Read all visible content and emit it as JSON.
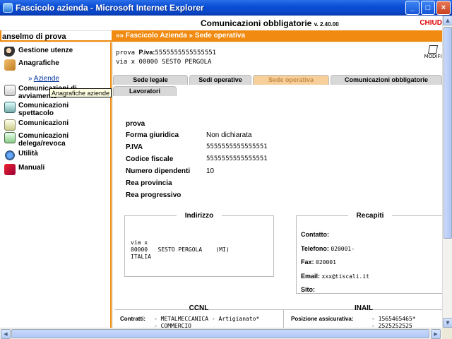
{
  "window": {
    "title": "Fascicolo azienda - Microsoft Internet Explorer",
    "buttons": {
      "minimize": "_",
      "maximize": "□",
      "close": "×"
    }
  },
  "header": {
    "title": "Comunicazioni obbligatorie",
    "version": "v. 2.40.00",
    "close_label": "CHIUD"
  },
  "user": {
    "name": "anselmo di prova"
  },
  "breadcrumb": "»» Fascicolo Azienda » Sede operativa",
  "sidebar": {
    "items": [
      {
        "label": "Gestione utenze",
        "icon": "users-icon"
      },
      {
        "label": "Anagrafiche",
        "icon": "book-icon"
      },
      {
        "label": "Comunicazioni di\navviamento",
        "icon": "document-icon"
      },
      {
        "label": "Comunicazioni\nspettacolo",
        "icon": "theater-icon"
      },
      {
        "label": "Comunicazioni",
        "icon": "mail-icon"
      },
      {
        "label": "Comunicazioni\ndelega/revoca",
        "icon": "delegation-icon"
      },
      {
        "label": "Utilità",
        "icon": "globe-icon"
      },
      {
        "label": "Manuali",
        "icon": "books-icon"
      }
    ],
    "submenu": {
      "prefix": "»",
      "label": "Aziende"
    },
    "tooltip": "Anagrafiche aziende"
  },
  "company": {
    "name": "prova",
    "piva_label": "P.iva:",
    "piva": "5555555555555551",
    "address_line": "via x 00000 SESTO PERGOLA",
    "modify_label": "MODIFI"
  },
  "tabs": [
    {
      "label": "Sede legale",
      "active": false
    },
    {
      "label": "Sedi operative",
      "active": false
    },
    {
      "label": "Sede operativa",
      "active": true
    },
    {
      "label": "Comunicazioni obbligatorie",
      "active": false
    },
    {
      "label": "Lavoratori",
      "active": false
    }
  ],
  "details": {
    "name": "prova",
    "rows": [
      {
        "label": "Forma giuridica",
        "value": "Non dichiarata"
      },
      {
        "label": "P.IVA",
        "value": "5555555555555551"
      },
      {
        "label": "Codice fiscale",
        "value": "5555555555555551"
      },
      {
        "label": "Numero dipendenti",
        "value": "10"
      },
      {
        "label": "Rea provincia",
        "value": ""
      },
      {
        "label": "Rea progressivo",
        "value": ""
      }
    ]
  },
  "address": {
    "title": "Indirizzo",
    "lines": "via x\n00000   SESTO PERGOLA    (MI)\nITALIA"
  },
  "contacts": {
    "title": "Recapiti",
    "contatto_label": "Contatto:",
    "contatto": "",
    "telefono_label": "Telefono:",
    "telefono": "020001-",
    "fax_label": "Fax:",
    "fax": "020001",
    "email_label": "Email:",
    "email": "xxx@tiscali.it",
    "sito_label": "Sito:",
    "sito": ""
  },
  "ccnl": {
    "title": "CCNL",
    "label": "Contratti:",
    "values": "- METALMECCANICA - Artigianato*\n- COMMERCIO"
  },
  "inail": {
    "title": "INAIL",
    "label": "Posizione assicurativa:",
    "values": "- 1565465465*\n- 2525252525"
  }
}
